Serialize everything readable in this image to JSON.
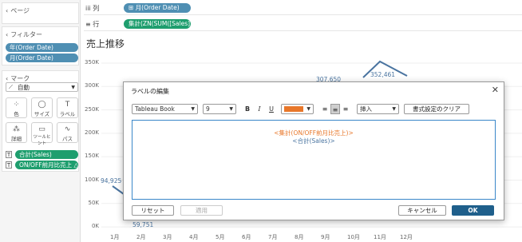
{
  "left_panel": {
    "pages": {
      "title": "ページ"
    },
    "filters": {
      "title": "フィルター",
      "items": [
        "年(Order Date)",
        "月(Order Date)"
      ]
    },
    "marks": {
      "title": "マーク",
      "type": "自動",
      "buttons": [
        "色",
        "サイズ",
        "ラベル",
        "詳細",
        "ツールヒント",
        "パス"
      ],
      "fields": [
        "合計(Sales)",
        "ON/OFF前月比売上 △"
      ]
    }
  },
  "shelves": {
    "columns": {
      "label": "列",
      "pill": "月(Order Date)"
    },
    "rows": {
      "label": "行",
      "pill": "集計(ZN(SUM([Sales]..."
    }
  },
  "chart_data": {
    "type": "line",
    "title": "売上推移",
    "categories": [
      "1月",
      "2月",
      "3月",
      "4月",
      "5月",
      "6月",
      "7月",
      "8月",
      "9月",
      "10月",
      "11月",
      "12月"
    ],
    "yticks": [
      "350K",
      "300K",
      "250K",
      "200K",
      "150K",
      "100K",
      "50K",
      "0K"
    ],
    "visible_labels": [
      "94,925",
      "59,751",
      "307,650",
      "352,461"
    ],
    "ylim": [
      0,
      350000
    ]
  },
  "dialog": {
    "title": "ラベルの編集",
    "font": "Tableau Book",
    "size": "9",
    "bold": "B",
    "italic": "I",
    "underline": "U",
    "insert_label": "挿入",
    "clear_label": "書式設定のクリア",
    "line1": "<集計(ON/OFF前月比売上)>",
    "line2": "<合計(Sales)>",
    "reset_label": "リセット",
    "apply_label": "適用",
    "cancel_label": "キャンセル",
    "ok_label": "OK",
    "colors": {
      "text_orange": "#e8772a",
      "text_blue": "#4a74a0",
      "ok": "#1f5f8b"
    }
  }
}
